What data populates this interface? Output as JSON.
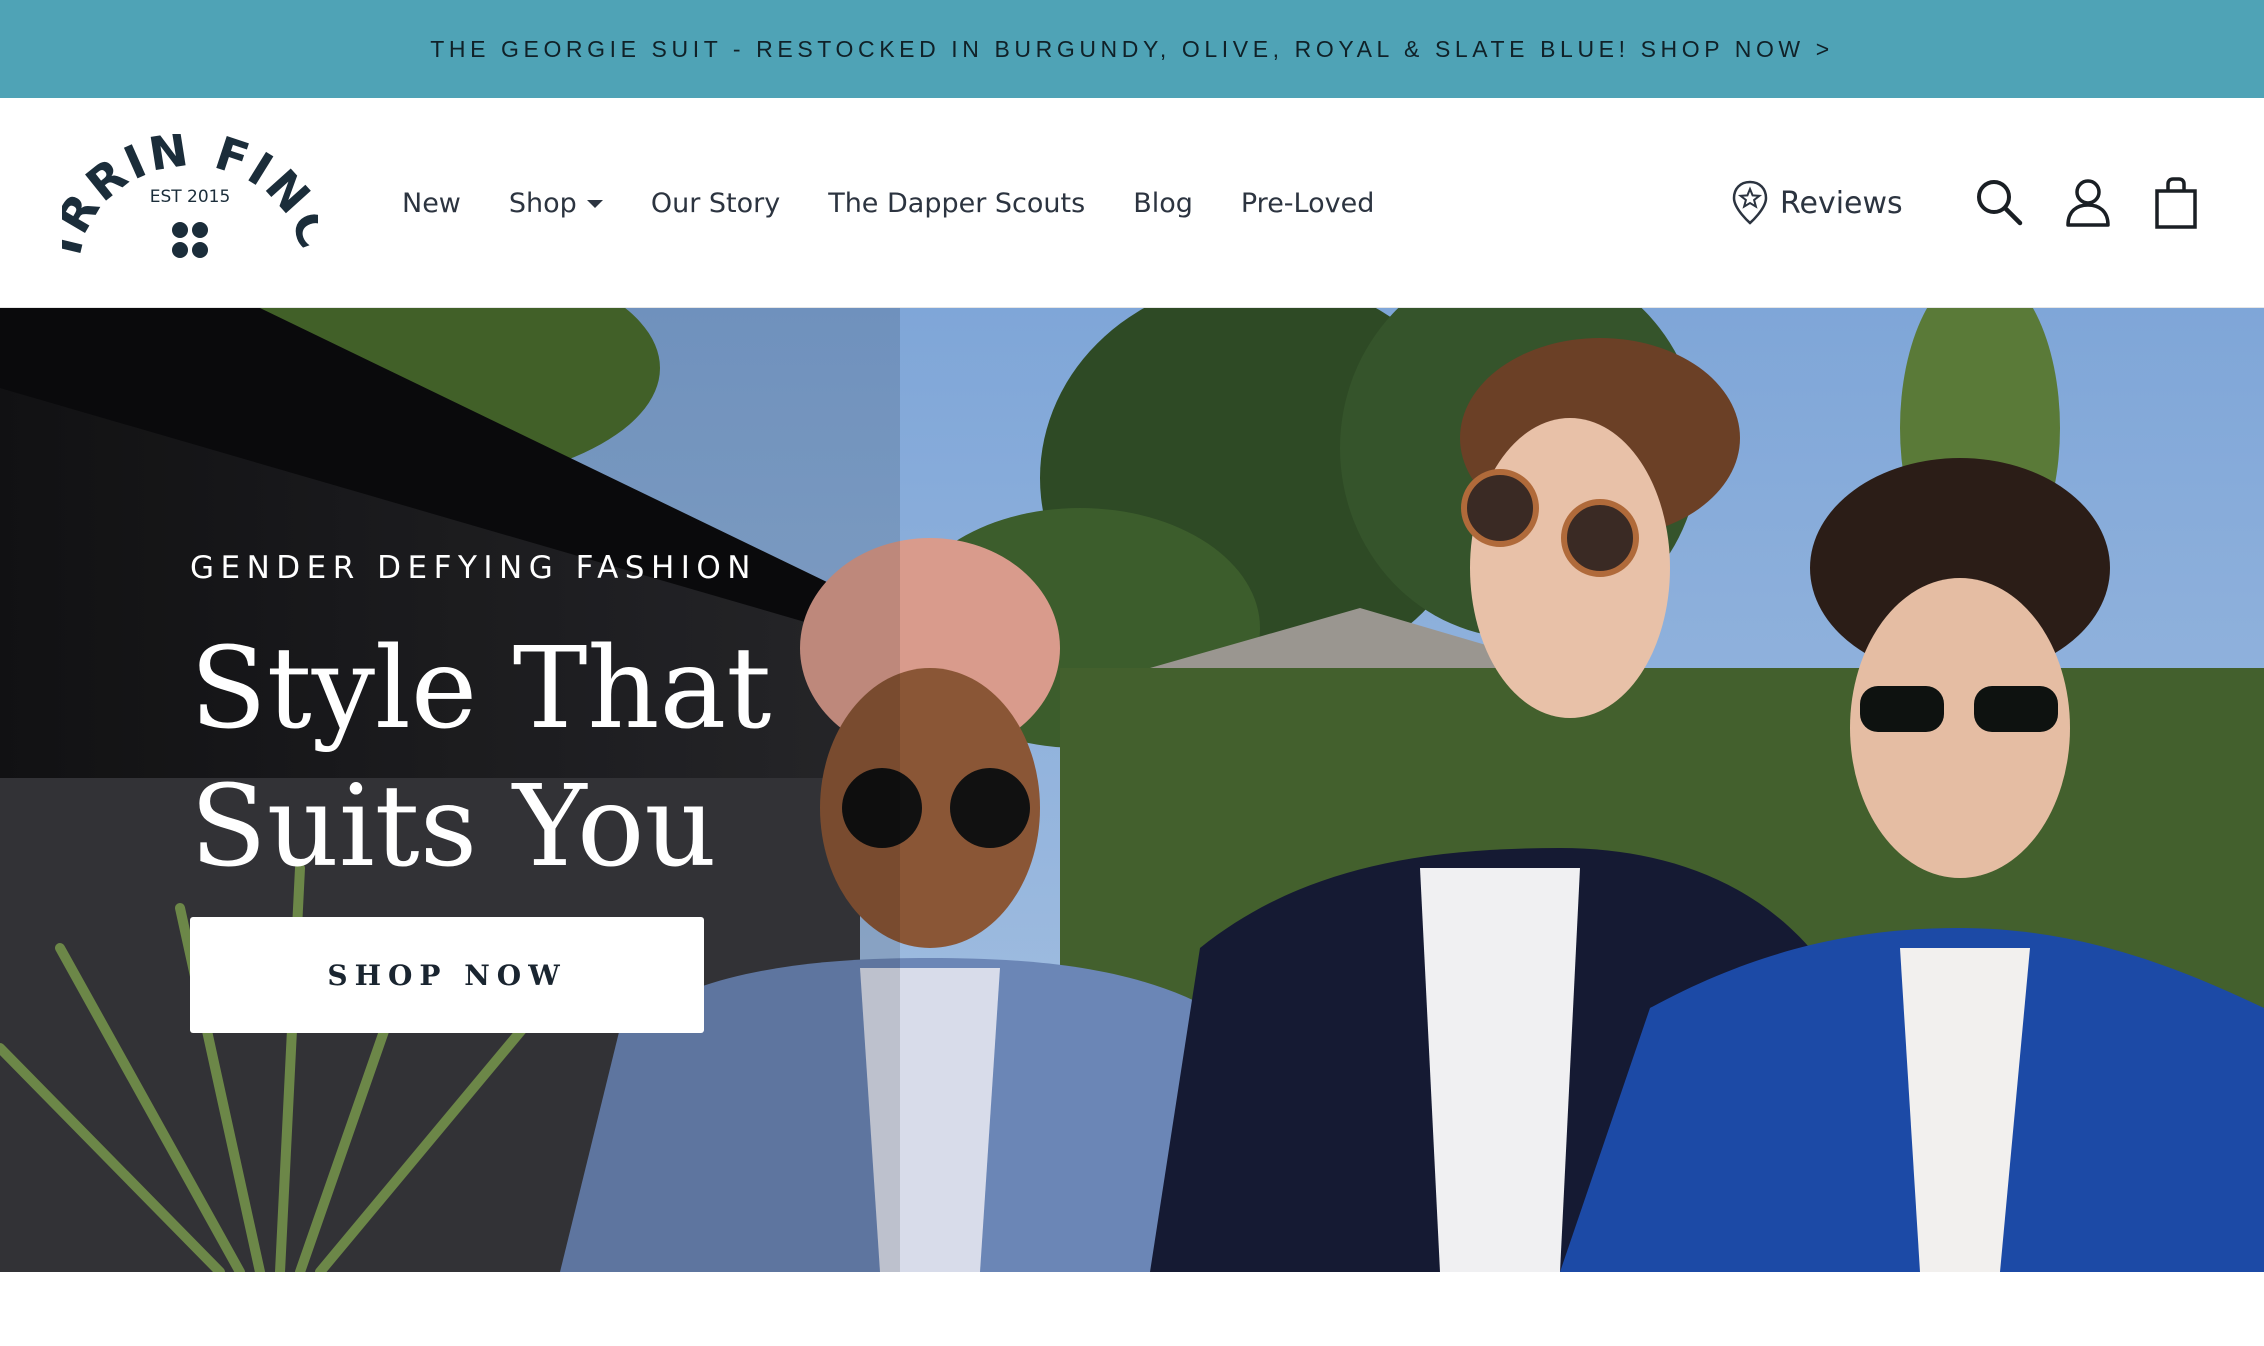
{
  "announcement": {
    "text": "THE GEORGIE SUIT - RESTOCKED IN BURGUNDY, OLIVE, ROYAL & SLATE BLUE! SHOP NOW >"
  },
  "logo": {
    "brand": "KIRRIN FINCH",
    "established": "EST 2015"
  },
  "nav": {
    "items": [
      {
        "label": "New"
      },
      {
        "label": "Shop",
        "has_dropdown": true
      },
      {
        "label": "Our Story"
      },
      {
        "label": "The Dapper Scouts"
      },
      {
        "label": "Blog"
      },
      {
        "label": "Pre-Loved"
      }
    ]
  },
  "header_actions": {
    "reviews_label": "Reviews",
    "icons": [
      "search-icon",
      "account-icon",
      "cart-icon"
    ]
  },
  "hero": {
    "eyebrow": "GENDER DEFYING FASHION",
    "headline_line1": "Style That",
    "headline_line2": "Suits You",
    "cta_label": "SHOP NOW"
  },
  "colors": {
    "announcement_bg": "#4fa3b6",
    "logo": "#1b2d3a",
    "text_dark": "#2c3440"
  }
}
